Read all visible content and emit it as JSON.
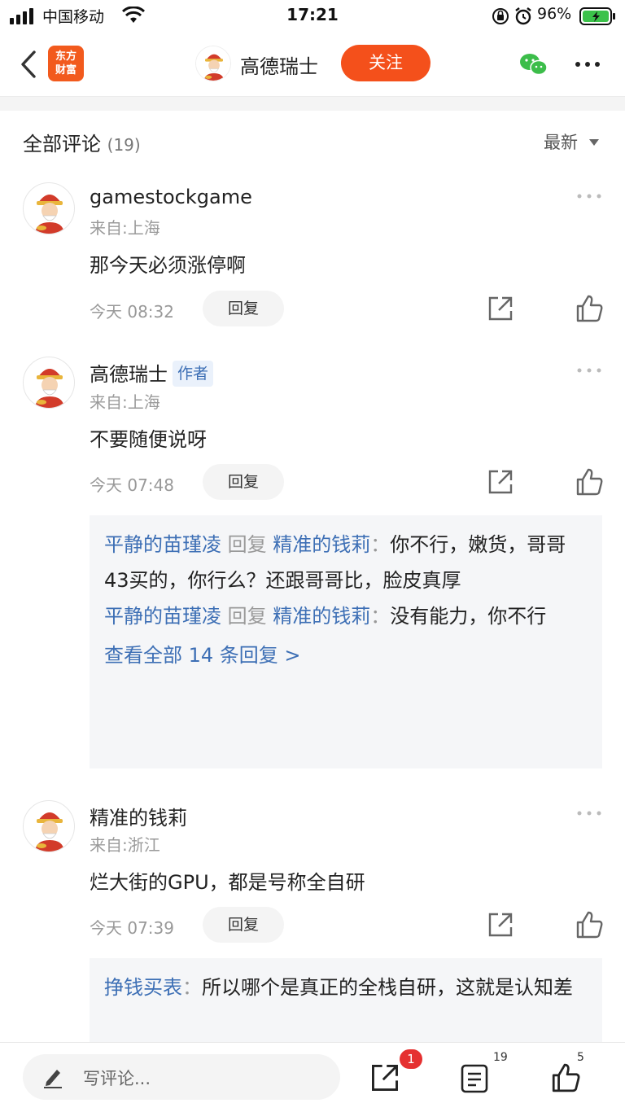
{
  "status_bar": {
    "carrier": "中国移动",
    "time": "17:21",
    "battery": "96%"
  },
  "nav": {
    "back": "back",
    "logo_line1": "东方",
    "logo_line2": "财富",
    "title": "高德瑞士",
    "follow_label": "关注"
  },
  "section": {
    "title": "全部评论",
    "count": "(19)",
    "sort_label": "最新"
  },
  "comments": [
    {
      "username": "gamestockgame",
      "location": "来自:上海",
      "text": "那今天必须涨停啊",
      "time": "今天 08:32",
      "reply_label": "回复"
    },
    {
      "username": "高德瑞士",
      "author_tag": "作者",
      "location": "来自:上海",
      "text": "不要随便说呀",
      "time": "今天 07:48",
      "reply_label": "回复",
      "replies": [
        {
          "from": "平静的苗瑾凌",
          "verb": "回复",
          "to": "精准的钱莉",
          "colon": "：",
          "text": "你不行，嫩货，哥哥 43买的，你行么？还跟哥哥比，脸皮真厚"
        },
        {
          "from": "平静的苗瑾凌",
          "verb": "回复",
          "to": "精准的钱莉",
          "colon": "：",
          "text": "没有能力，你不行"
        }
      ],
      "see_all": "查看全部 14 条回复 >"
    },
    {
      "username": "精准的钱莉",
      "location": "来自:浙江",
      "text": "烂大街的GPU，都是号称全自研",
      "time": "今天 07:39",
      "reply_label": "回复",
      "replies": [
        {
          "from": "挣钱买表",
          "colon": "：",
          "text": "所以哪个是真正的全栈自研，这就是认知差"
        }
      ]
    }
  ],
  "bottom_bar": {
    "input_placeholder": "写评论...",
    "share_badge": "1",
    "comment_count": "19",
    "like_count": "5"
  },
  "colors": {
    "brand_orange": "#f4501b",
    "link_blue": "#3d6fb5",
    "badge_red": "#e53030"
  }
}
